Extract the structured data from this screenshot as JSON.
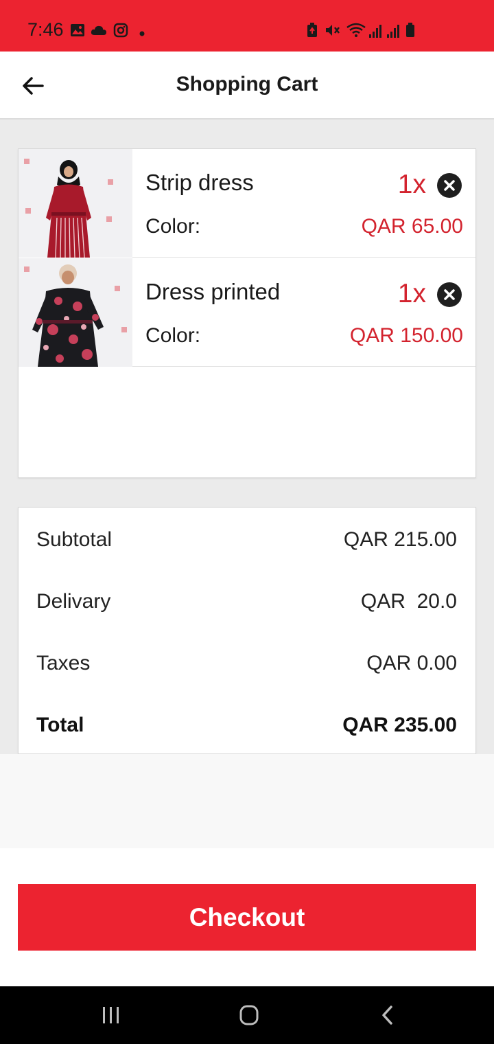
{
  "status_bar": {
    "time": "7:46",
    "left_icons": [
      "gallery-icon",
      "cloud-icon",
      "instagram-icon",
      "dot-icon"
    ],
    "right_icons": [
      "battery-saver-icon",
      "mute-icon",
      "wifi-icon",
      "signal-icon",
      "signal-icon",
      "battery-icon"
    ]
  },
  "app_bar": {
    "title": "Shopping Cart",
    "back_icon": "arrow-left-icon"
  },
  "cart": {
    "items": [
      {
        "name": "Strip dress",
        "color_label": "Color:",
        "quantity": "1x",
        "price": "QAR 65.00",
        "remove_icon": "close-circle-icon"
      },
      {
        "name": "Dress printed",
        "color_label": "Color:",
        "quantity": "1x",
        "price": "QAR 150.00",
        "remove_icon": "close-circle-icon"
      }
    ]
  },
  "summary": {
    "subtotal_label": "Subtotal",
    "subtotal_value": "QAR 215.00",
    "delivery_label": "Delivary",
    "delivery_value": "QAR  20.0",
    "taxes_label": "Taxes",
    "taxes_value": "QAR 0.00",
    "total_label": "Total",
    "total_value": "QAR 235.00"
  },
  "checkout_label": "Checkout",
  "nav_bar": {
    "icons": [
      "recent-apps-icon",
      "home-icon",
      "back-icon"
    ]
  },
  "colors": {
    "brand_red": "#ec2330",
    "price_red": "#d3232e",
    "background": "#ebebeb"
  }
}
